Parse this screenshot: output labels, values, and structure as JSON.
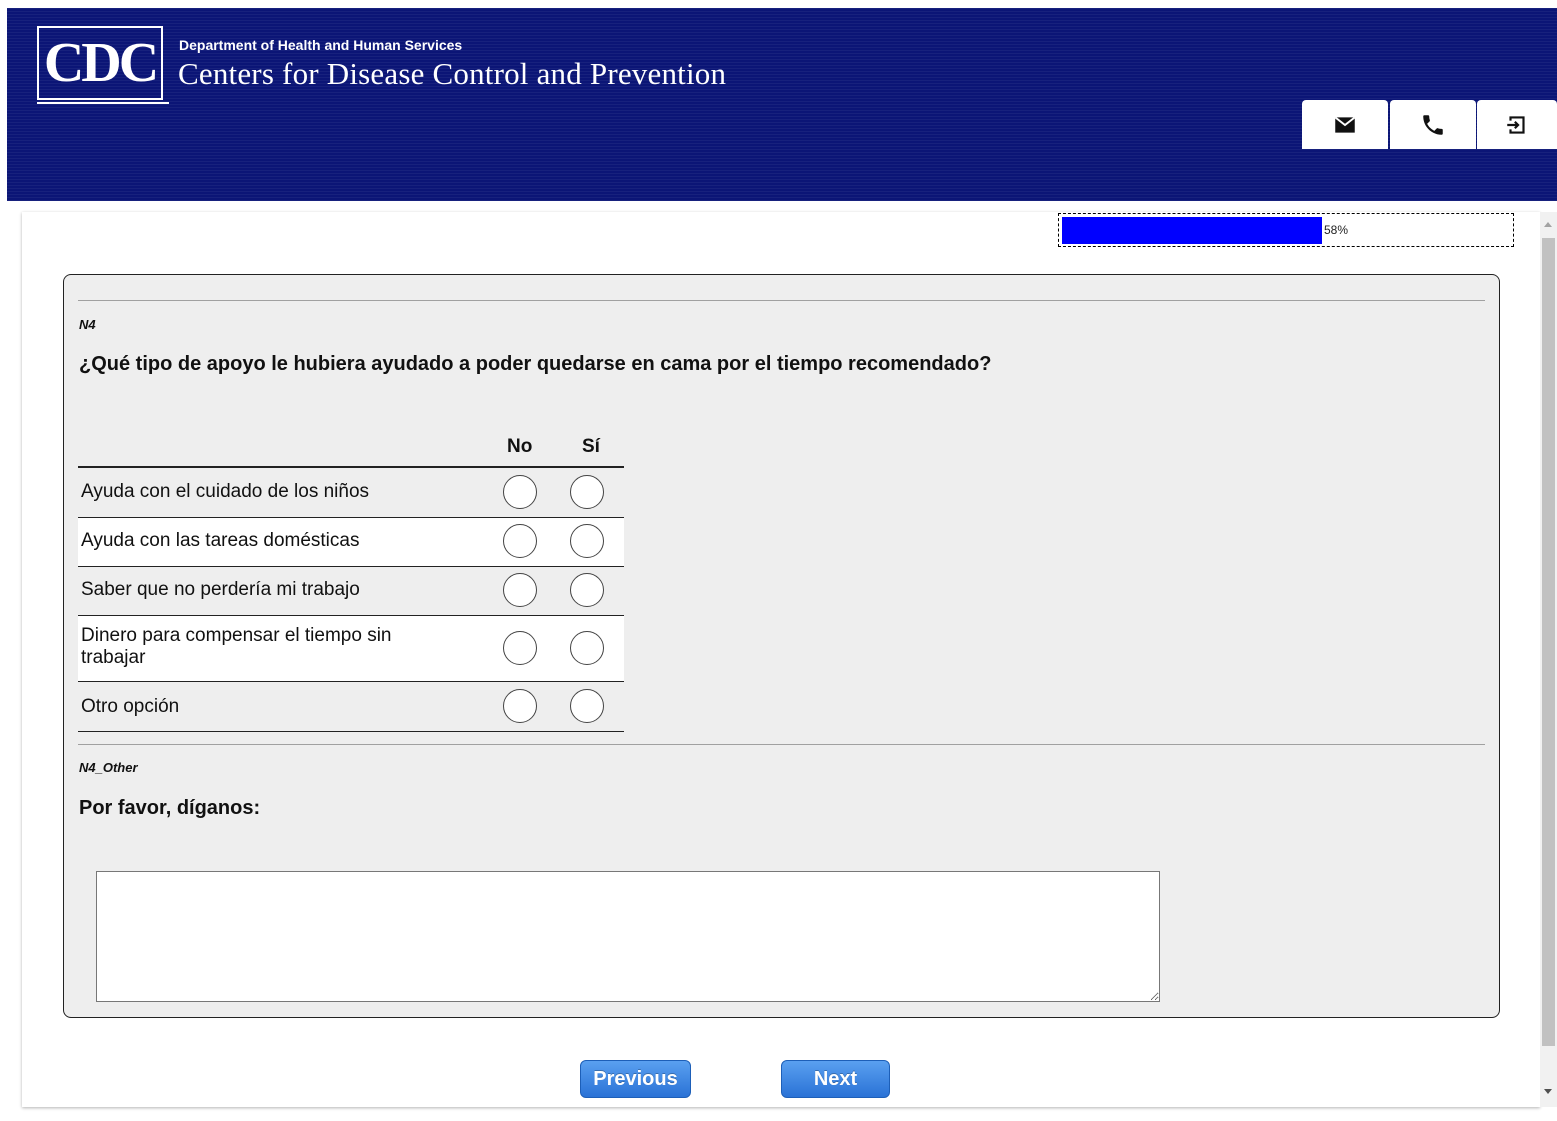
{
  "header": {
    "logo_text": "CDC",
    "department": "Department of Health and Human Services",
    "agency": "Centers for Disease Control and Prevention",
    "buttons": [
      "mail-icon",
      "phone-icon",
      "exit-icon"
    ]
  },
  "progress": {
    "percent": 58,
    "label": "58%"
  },
  "question": {
    "id": "N4",
    "text": "¿Qué tipo de apoyo le hubiera ayudado a poder quedarse en cama por el tiempo recomendado?",
    "columns": [
      "No",
      "Sí"
    ],
    "rows": [
      "Ayuda con el cuidado de los niños",
      "Ayuda con las tareas domésticas",
      "Saber que no perdería mi trabajo",
      "Dinero para compensar el tiempo sin trabajar",
      "Otro opción"
    ]
  },
  "other": {
    "id": "N4_Other",
    "text": "Por favor, díganos:",
    "value": ""
  },
  "nav": {
    "previous": "Previous",
    "next": "Next"
  }
}
